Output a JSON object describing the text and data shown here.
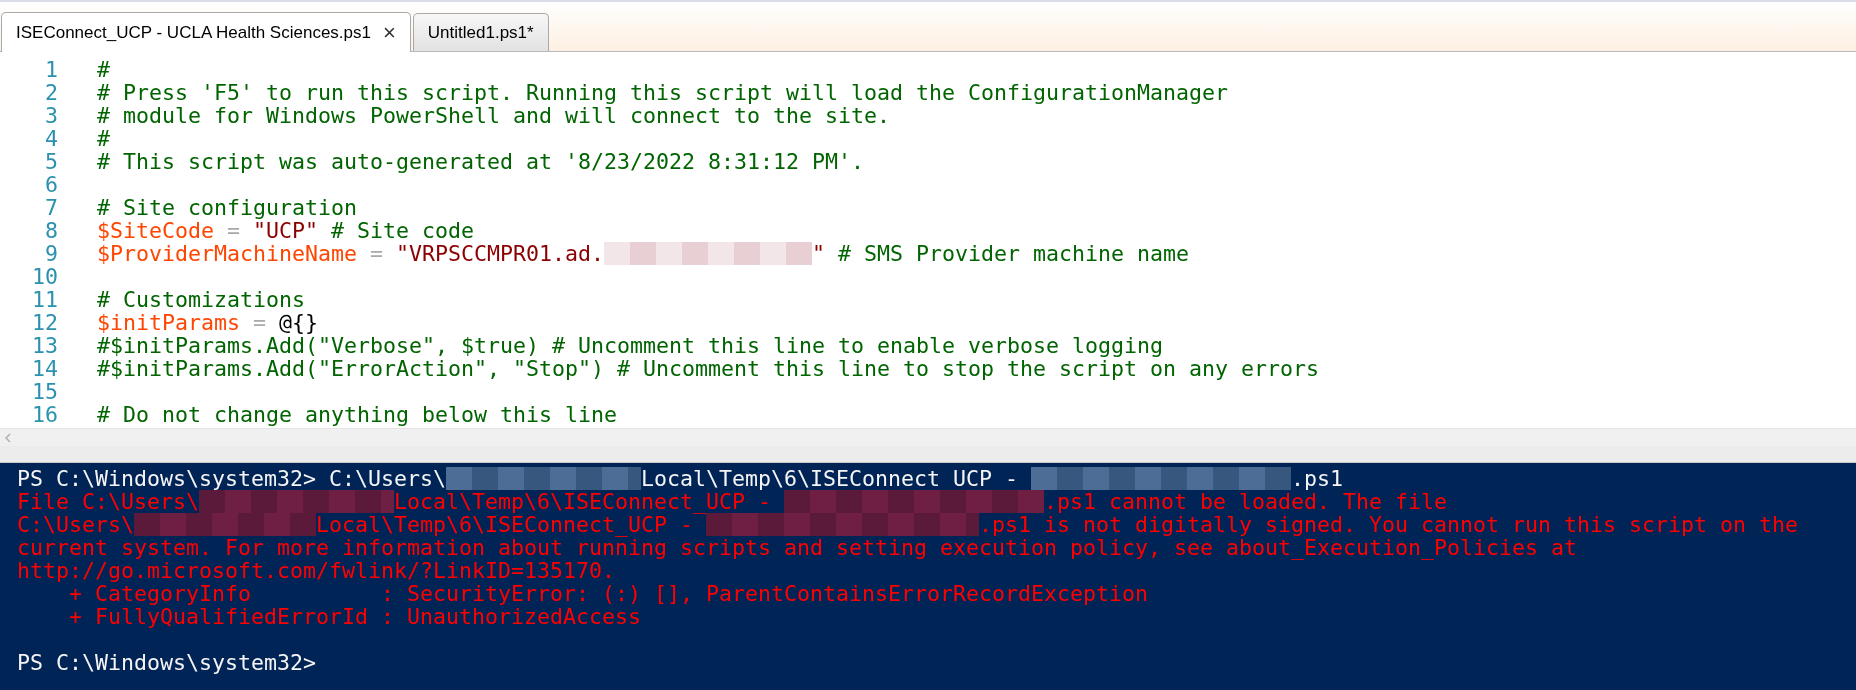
{
  "tabs": [
    {
      "label": "ISEConnect_UCP - UCLA Health Sciences.ps1",
      "close": "×",
      "selected": true
    },
    {
      "label": "Untitled1.ps1*",
      "selected": false
    }
  ],
  "editor": {
    "lines": [
      {
        "number": "1",
        "segments": [
          {
            "kind": "comment",
            "text": "#"
          }
        ]
      },
      {
        "number": "2",
        "segments": [
          {
            "kind": "comment",
            "text": "# Press 'F5' to run this script. Running this script will load the ConfigurationManager"
          }
        ]
      },
      {
        "number": "3",
        "segments": [
          {
            "kind": "comment",
            "text": "# module for Windows PowerShell and will connect to the site."
          }
        ]
      },
      {
        "number": "4",
        "segments": [
          {
            "kind": "comment",
            "text": "#"
          }
        ]
      },
      {
        "number": "5",
        "segments": [
          {
            "kind": "comment",
            "text": "# This script was auto-generated at '8/23/2022 8:31:12 PM'."
          }
        ]
      },
      {
        "number": "6"
      },
      {
        "number": "7",
        "segments": [
          {
            "kind": "comment",
            "text": "# Site configuration"
          }
        ]
      },
      {
        "number": "8",
        "segments": [
          {
            "kind": "variable",
            "text": "$SiteCode"
          },
          {
            "kind": "operator",
            "text": " = "
          },
          {
            "kind": "string",
            "text": "\"UCP\""
          },
          {
            "kind": "comment",
            "text": " # Site code"
          }
        ]
      },
      {
        "number": "9",
        "segments": [
          {
            "kind": "variable",
            "text": "$ProviderMachineName"
          },
          {
            "kind": "operator",
            "text": " = "
          },
          {
            "kind": "string",
            "text": "\"VRPSCCMPR01.ad."
          },
          {
            "kind": "redacted"
          },
          {
            "kind": "string",
            "text": "\""
          },
          {
            "kind": "comment",
            "text": " # SMS Provider machine name"
          }
        ]
      },
      {
        "number": "10"
      },
      {
        "number": "11",
        "segments": [
          {
            "kind": "comment",
            "text": "# Customizations"
          }
        ]
      },
      {
        "number": "12",
        "segments": [
          {
            "kind": "variable",
            "text": "$initParams"
          },
          {
            "kind": "operator",
            "text": " = "
          },
          {
            "kind": "plain",
            "text": "@{}"
          }
        ]
      },
      {
        "number": "13",
        "segments": [
          {
            "kind": "comment",
            "text": "#$initParams.Add(\"Verbose\", $true) # Uncomment this line to enable verbose logging"
          }
        ]
      },
      {
        "number": "14",
        "segments": [
          {
            "kind": "comment",
            "text": "#$initParams.Add(\"ErrorAction\", \"Stop\") # Uncomment this line to stop the script on any errors"
          }
        ]
      },
      {
        "number": "15"
      },
      {
        "number": "16",
        "segments": [
          {
            "kind": "comment",
            "text": "# Do not change anything below this line"
          }
        ]
      }
    ]
  },
  "console": {
    "lines": [
      {
        "kind": "output",
        "segments": [
          {
            "kind": "text",
            "text": "PS C:\\Windows\\system32> C:\\Users\\"
          },
          {
            "kind": "redacted"
          },
          {
            "kind": "text",
            "text": "Local\\Temp\\6\\ISEConnect_UCP - "
          },
          {
            "kind": "redacted"
          },
          {
            "kind": "text",
            "text": ".ps1"
          }
        ]
      },
      {
        "kind": "error",
        "segments": [
          {
            "kind": "text",
            "text": "File C:\\Users\\"
          },
          {
            "kind": "redacted"
          },
          {
            "kind": "text",
            "text": "Local\\Temp\\6\\ISEConnect_UCP - "
          },
          {
            "kind": "redacted"
          },
          {
            "kind": "text",
            "text": ".ps1 cannot be loaded. The file"
          }
        ]
      },
      {
        "kind": "error",
        "segments": [
          {
            "kind": "text",
            "text": "C:\\Users\\"
          },
          {
            "kind": "redacted"
          },
          {
            "kind": "text",
            "text": "Local\\Temp\\6\\ISEConnect_UCP - "
          },
          {
            "kind": "redacted"
          },
          {
            "kind": "text",
            "text": ".ps1 is not digitally signed. You cannot run this script on the"
          }
        ]
      },
      {
        "kind": "error",
        "segments": [
          {
            "kind": "text",
            "text": "current system. For more information about running scripts and setting execution policy, see about_Execution_Policies at"
          }
        ]
      },
      {
        "kind": "error",
        "segments": [
          {
            "kind": "text",
            "text": "http://go.microsoft.com/fwlink/?LinkID=135170."
          }
        ]
      },
      {
        "kind": "error",
        "segments": [
          {
            "kind": "text",
            "text": "    + CategoryInfo          : SecurityError: (:) [], ParentContainsErrorRecordException"
          }
        ]
      },
      {
        "kind": "error",
        "segments": [
          {
            "kind": "text",
            "text": "    + FullyQualifiedErrorId : UnauthorizedAccess"
          }
        ]
      },
      {
        "kind": "output"
      },
      {
        "kind": "output",
        "segments": [
          {
            "kind": "text",
            "text": "PS C:\\Windows\\system32>"
          }
        ]
      }
    ]
  }
}
